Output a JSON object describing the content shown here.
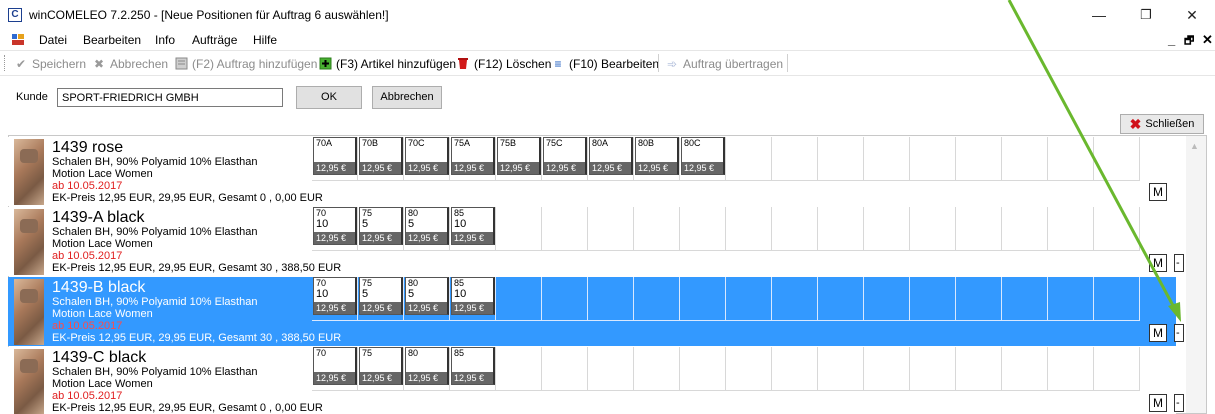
{
  "window": {
    "title": "winCOMELEO 7.2.250 - [Neue Positionen für Auftrag 6 auswählen!]",
    "icon": "C",
    "minimize": "—",
    "restore": "❐",
    "close": "✕"
  },
  "menu": {
    "items": [
      "Datei",
      "Bearbeiten",
      "Info",
      "Aufträge",
      "Hilfe"
    ],
    "mdi_min": "_",
    "mdi_restore": "🗗",
    "mdi_close": "✕"
  },
  "toolbar": {
    "save": "Speichern",
    "cancel": "Abbrechen",
    "add_order": "(F2) Auftrag hinzufügen",
    "add_article": "(F3) Artikel hinzufügen",
    "delete": "(F12) Löschen",
    "edit": "(F10) Bearbeiten",
    "transfer": "Auftrag übertragen"
  },
  "form": {
    "kunde_label": "Kunde",
    "kunde_value": "SPORT-FRIEDRICH GMBH",
    "ok": "OK",
    "cancel": "Abbrechen",
    "close": "Schließen"
  },
  "rows": [
    {
      "name": "1439 rose",
      "desc": "Schalen BH, 90% Polyamid 10% Elasthan",
      "line": "Motion Lace Women",
      "date": "ab 10.05.2017",
      "price": "EK-Preis 12,95 EUR,  29,95 EUR, Gesamt 0 ,  0,00 EUR",
      "selected": false,
      "sizes": [
        {
          "label": "70A",
          "qty": "",
          "price": "12,95 €"
        },
        {
          "label": "70B",
          "qty": "",
          "price": "12,95 €"
        },
        {
          "label": "70C",
          "qty": "",
          "price": "12,95 €"
        },
        {
          "label": "75A",
          "qty": "",
          "price": "12,95 €"
        },
        {
          "label": "75B",
          "qty": "",
          "price": "12,95 €"
        },
        {
          "label": "75C",
          "qty": "",
          "price": "12,95 €"
        },
        {
          "label": "80A",
          "qty": "",
          "price": "12,95 €"
        },
        {
          "label": "80B",
          "qty": "",
          "price": "12,95 €"
        },
        {
          "label": "80C",
          "qty": "",
          "price": "12,95 €"
        }
      ]
    },
    {
      "name": "1439-A black",
      "desc": "Schalen BH, 90% Polyamid 10% Elasthan",
      "line": "Motion Lace Women",
      "date": "ab 10.05.2017",
      "price": "EK-Preis 12,95 EUR,  29,95 EUR, Gesamt 30 ,  388,50 EUR",
      "selected": false,
      "sizes": [
        {
          "label": "70",
          "qty": "10",
          "price": "12,95 €"
        },
        {
          "label": "75",
          "qty": "5",
          "price": "12,95 €"
        },
        {
          "label": "80",
          "qty": "5",
          "price": "12,95 €"
        },
        {
          "label": "85",
          "qty": "10",
          "price": "12,95 €"
        }
      ]
    },
    {
      "name": "1439-B black",
      "desc": "Schalen BH, 90% Polyamid 10% Elasthan",
      "line": "Motion Lace Women",
      "date": "ab 10.05.2017",
      "price": "EK-Preis 12,95 EUR,  29,95 EUR, Gesamt 30 ,  388,50 EUR",
      "selected": true,
      "sizes": [
        {
          "label": "70",
          "qty": "10",
          "price": "12,95 €"
        },
        {
          "label": "75",
          "qty": "5",
          "price": "12,95 €"
        },
        {
          "label": "80",
          "qty": "5",
          "price": "12,95 €"
        },
        {
          "label": "85",
          "qty": "10",
          "price": "12,95 €"
        }
      ]
    },
    {
      "name": "1439-C black",
      "desc": "Schalen BH, 90% Polyamid 10% Elasthan",
      "line": "Motion Lace Women",
      "date": "ab 10.05.2017",
      "price": "EK-Preis 12,95 EUR,  29,95 EUR, Gesamt 0 ,  0,00 EUR",
      "selected": false,
      "sizes": [
        {
          "label": "70",
          "qty": "",
          "price": "12,95 €"
        },
        {
          "label": "75",
          "qty": "",
          "price": "12,95 €"
        },
        {
          "label": "80",
          "qty": "",
          "price": "12,95 €"
        },
        {
          "label": "85",
          "qty": "",
          "price": "12,95 €"
        }
      ]
    }
  ],
  "row_button": "M",
  "row_edge_button": "-",
  "scroll_up": "▲",
  "colors": {
    "selection": "#3399ff",
    "date": "#e02020",
    "arrow": "#6ab82e"
  }
}
